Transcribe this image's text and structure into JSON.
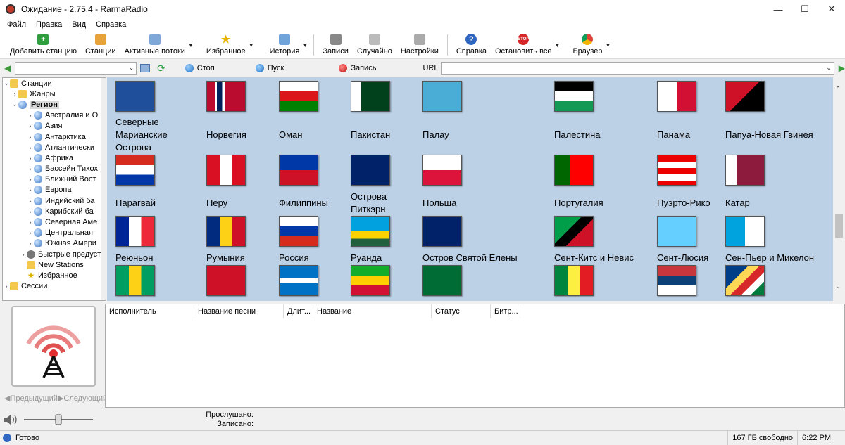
{
  "window": {
    "title": "Ожидание - 2.75.4 - RarmaRadio"
  },
  "menu": [
    "Файл",
    "Правка",
    "Вид",
    "Справка"
  ],
  "toolbar": {
    "add_station": "Добавить станцию",
    "stations": "Станции",
    "active_streams": "Активные потоки",
    "favorites": "Избранное",
    "history": "История",
    "records": "Записи",
    "random": "Случайно",
    "settings": "Настройки",
    "help": "Справка",
    "stop_all": "Остановить все",
    "browser": "Браузер"
  },
  "player": {
    "stop": "Стоп",
    "play": "Пуск",
    "record": "Запись",
    "url_label": "URL",
    "station_value": "",
    "url_value": ""
  },
  "tree": {
    "root": "Станции",
    "genres": "Жанры",
    "region": "Регион",
    "regions": [
      "Австралия и О",
      "Азия",
      "Антарктика",
      "Атлантически",
      "Африка",
      "Бассейн Тихох",
      "Ближний Вост",
      "Европа",
      "Индийский ба",
      "Карибский ба",
      "Северная Аме",
      "Центральная",
      "Южная Амери"
    ],
    "quick": "Быстрые предуст",
    "new_stations": "New Stations",
    "favorites": "Избранное",
    "sessions": "Сессии"
  },
  "countries": [
    [
      "Северные Марианские Острова",
      "Норвегия",
      "Оман",
      "Пакистан",
      "Палау",
      "Палестина",
      "Панама",
      "Папуа-Новая Гвинея"
    ],
    [
      "Парагвай",
      "Перу",
      "Филиппины",
      "Острова Питкэрн",
      "Польша",
      "Португалия",
      "Пуэрто-Рико",
      "Катар"
    ],
    [
      "Реюньон",
      "Румыния",
      "Россия",
      "Руанда",
      "Остров Святой Елены",
      "Сент-Китс и Невис",
      "Сент-Люсия",
      "Сен-Пьер и Микелон"
    ]
  ],
  "song_columns": [
    "Исполнитель",
    "Название песни",
    "Длит...",
    "Название",
    "Статус",
    "Битр..."
  ],
  "nav": {
    "prev": "Предыдущий",
    "next": "Следующий"
  },
  "info": {
    "listened": "Прослушано:",
    "recorded": "Записано:"
  },
  "status": {
    "ready": "Готово",
    "free": "167 ГБ свободно",
    "time": "6:22 PM"
  }
}
